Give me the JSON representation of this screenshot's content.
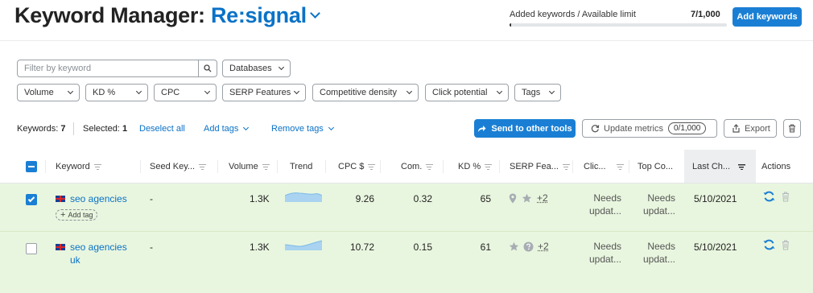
{
  "header": {
    "title": "Keyword Manager:",
    "project": "Re:signal",
    "limit_label": "Added keywords / Available limit",
    "limit_value": "7/1,000",
    "limit_fraction": 0.007,
    "add_keywords_label": "Add keywords"
  },
  "filters": {
    "search_placeholder": "Filter by keyword",
    "databases": "Databases",
    "dropdowns": [
      "Volume",
      "KD %",
      "CPC",
      "SERP Features",
      "Competitive density",
      "Click potential",
      "Tags"
    ]
  },
  "toolbar": {
    "keywords_label": "Keywords:",
    "keywords_count": "7",
    "selected_label": "Selected:",
    "selected_count": "1",
    "deselect_all": "Deselect all",
    "add_tags": "Add tags",
    "remove_tags": "Remove tags",
    "send_to_other_tools": "Send to other tools",
    "update_metrics": "Update metrics",
    "update_count": "0/1,000",
    "export": "Export"
  },
  "table": {
    "headers": {
      "keyword": "Keyword",
      "seed": "Seed Key...",
      "volume": "Volume",
      "trend": "Trend",
      "cpc": "CPC $",
      "com": "Com.",
      "kd": "KD %",
      "serp": "SERP Fea...",
      "click": "Clic...",
      "top": "Top Co...",
      "last": "Last Ch...",
      "actions": "Actions"
    },
    "rows": [
      {
        "keyword": "seo agencies",
        "keyword_line2": "",
        "seed": "-",
        "volume": "1.3K",
        "cpc": "9.26",
        "com": "0.32",
        "kd": "65",
        "serp_more": "+2",
        "click_1": "Needs",
        "click_2": "updat...",
        "top_1": "Needs",
        "top_2": "updat...",
        "last": "5/10/2021",
        "add_tag": "Add tag",
        "checked": true
      },
      {
        "keyword": "seo agencies",
        "keyword_line2": "uk",
        "seed": "-",
        "volume": "1.3K",
        "cpc": "10.72",
        "com": "0.15",
        "kd": "61",
        "serp_more": "+2",
        "click_1": "Needs",
        "click_2": "updat...",
        "top_1": "Needs",
        "top_2": "updat...",
        "last": "5/10/2021",
        "checked": false
      }
    ]
  },
  "colors": {
    "accent": "#1a7fd4",
    "row_bg": "#e9f6df"
  }
}
